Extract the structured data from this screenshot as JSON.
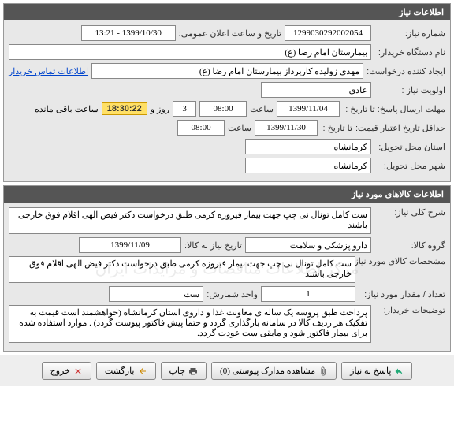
{
  "panel1": {
    "title": "اطلاعات نیاز",
    "need_number_label": "شماره نیاز:",
    "need_number": "1299030292002054",
    "announce_label": "تاریخ و ساعت اعلان عمومی:",
    "announce_value": "1399/10/30 - 13:21",
    "org_label": "نام دستگاه خریدار:",
    "org_value": "بیمارستان امام رضا (ع)",
    "requester_label": "ایجاد کننده درخواست:",
    "requester_value": "مهدی زولیده کارپرداز بیمارستان امام رضا (ع)",
    "contact_link": "اطلاعات تماس خریدار",
    "priority_label": "اولویت نیاز :",
    "priority_value": "عادی",
    "deadline_label": "مهلت ارسال پاسخ:  تا تاریخ :",
    "deadline_date": "1399/11/04",
    "time_label": "ساعت",
    "deadline_time": "08:00",
    "days_value": "3",
    "days_label": "روز و",
    "countdown": "18:30:22",
    "remain_label": "ساعت باقی مانده",
    "validity_label": "حداقل تاریخ اعتبار قیمت:",
    "validity_to": "تا تاریخ :",
    "validity_date": "1399/11/30",
    "validity_time": "08:00",
    "province_label": "استان محل تحویل:",
    "province_value": "کرمانشاه",
    "city_label": "شهر محل تحویل:",
    "city_value": "کرمانشاه"
  },
  "panel2": {
    "title": "اطلاعات کالاهای مورد نیاز",
    "desc_label": "شرح کلی نیاز:",
    "desc_value": "ست کامل تونال نی چپ جهت بیمار فیروزه کرمی طبق درخواست دکتر فیض الهی اقلام فوق خارجی باشند",
    "group_label": "گروه کالا:",
    "group_value": "دارو پزشکی و سلامت",
    "need_date_label": "تاریخ نیاز به کالا:",
    "need_date_value": "1399/11/09",
    "spec_label": "مشخصات کالای مورد نیاز:",
    "spec_value": "ست کامل تونال نی چپ جهت بیمار فیروزه کرمی طبق درخواست دکتر فیض الهی اقلام فوق خارجی باشند",
    "qty_label": "تعداد / مقدار مورد نیاز:",
    "qty_value": "1",
    "unit_label": "واحد شمارش:",
    "unit_value": "ست",
    "notes_label": "توضیحات خریدار:",
    "notes_value": "پرداخت طبق پروسه یک ساله ی معاونت غذا و داروی استان کرمانشاه (خواهشمند است قیمت به تفکیک هر ردیف کالا در سامانه بارگذاری گردد و حتما پیش فاکتور پیوست گردد) . موارد استفاده شده برای بیمار فاکتور شود و مابقی ست عودت گردد.",
    "watermark": "مرکز اطلاعات مناقصات و مزایدات ایران"
  },
  "buttons": {
    "reply": "پاسخ به نیاز",
    "attachments": "مشاهده مدارک پیوستی (0)",
    "print": "چاپ",
    "back": "بازگشت",
    "exit": "خروج"
  }
}
